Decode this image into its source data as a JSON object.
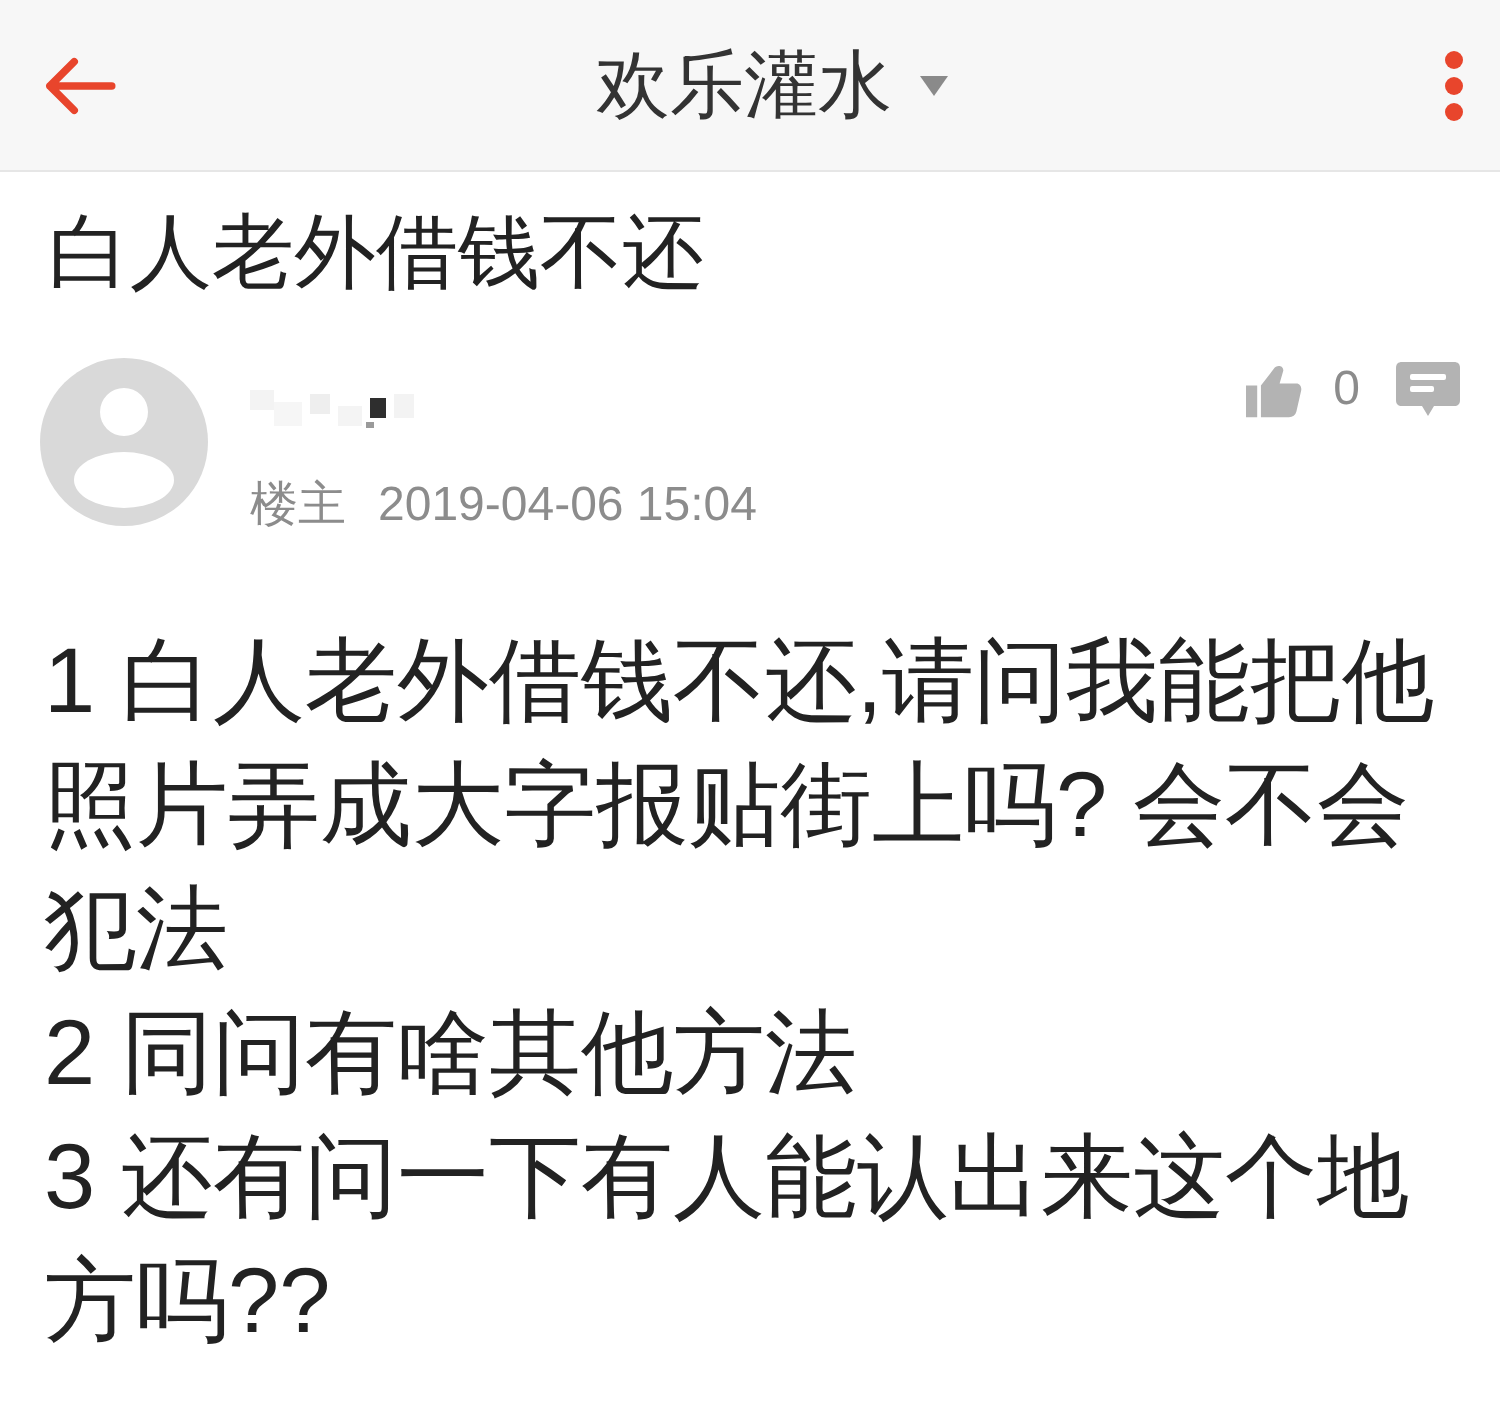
{
  "header": {
    "title": "欢乐灌水"
  },
  "post": {
    "title": "白人老外借钱不还",
    "author": {
      "role": "楼主",
      "time": "2019-04-06 15:04"
    },
    "likes": "0",
    "body": [
      "1 白人老外借钱不还,请问我能把他照片弄成大字报贴街上吗? 会不会犯法",
      "2 同问有啥其他方法",
      "3 还有问一下有人能认出来这个地方吗??"
    ]
  }
}
